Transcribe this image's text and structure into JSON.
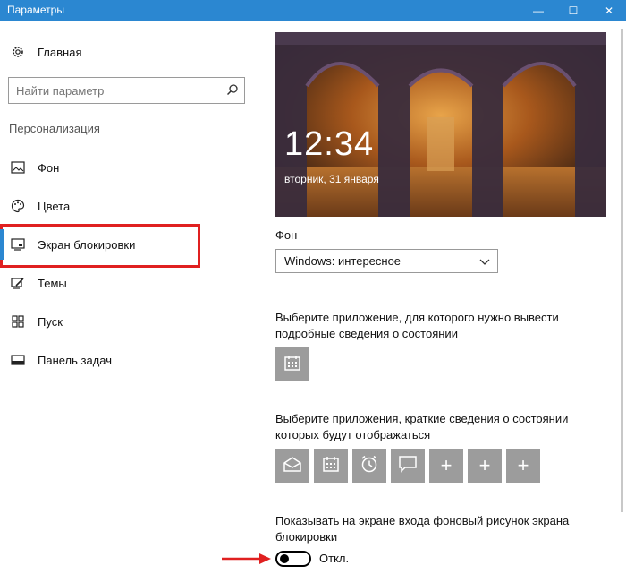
{
  "window": {
    "title": "Параметры",
    "minimize": "—",
    "maximize": "☐",
    "close": "✕"
  },
  "sidebar": {
    "home_label": "Главная",
    "search_placeholder": "Найти параметр",
    "section_title": "Персонализация",
    "items": [
      {
        "label": "Фон",
        "icon": "picture-icon"
      },
      {
        "label": "Цвета",
        "icon": "palette-icon"
      },
      {
        "label": "Экран блокировки",
        "icon": "lock-screen-icon",
        "selected": true
      },
      {
        "label": "Темы",
        "icon": "themes-icon"
      },
      {
        "label": "Пуск",
        "icon": "start-icon"
      },
      {
        "label": "Панель задач",
        "icon": "taskbar-icon"
      }
    ]
  },
  "main": {
    "preview": {
      "time": "12:34",
      "date": "вторник, 31 января"
    },
    "background_label": "Фон",
    "background_value": "Windows: интересное",
    "detailed_status_label": "Выберите приложение, для которого нужно вывести подробные сведения о состоянии",
    "detailed_status_app": "calendar-icon",
    "quick_status_label": "Выберите приложения, краткие сведения о состоянии которых будут отображаться",
    "quick_status_apps": [
      "mail-icon",
      "calendar-icon",
      "alarm-icon",
      "message-icon",
      "add-icon",
      "add-icon",
      "add-icon"
    ],
    "add_symbol": "+",
    "signin_bg_label": "Показывать на экране входа фоновый рисунок экрана блокировки",
    "signin_bg_toggle_state": "Откл.",
    "signin_bg_toggle_on": false
  },
  "colors": {
    "titlebar": "#2b87d1",
    "selection_highlight": "#e02020",
    "tile_bg": "#9c9c9c",
    "annotation_arrow": "#e02020"
  }
}
